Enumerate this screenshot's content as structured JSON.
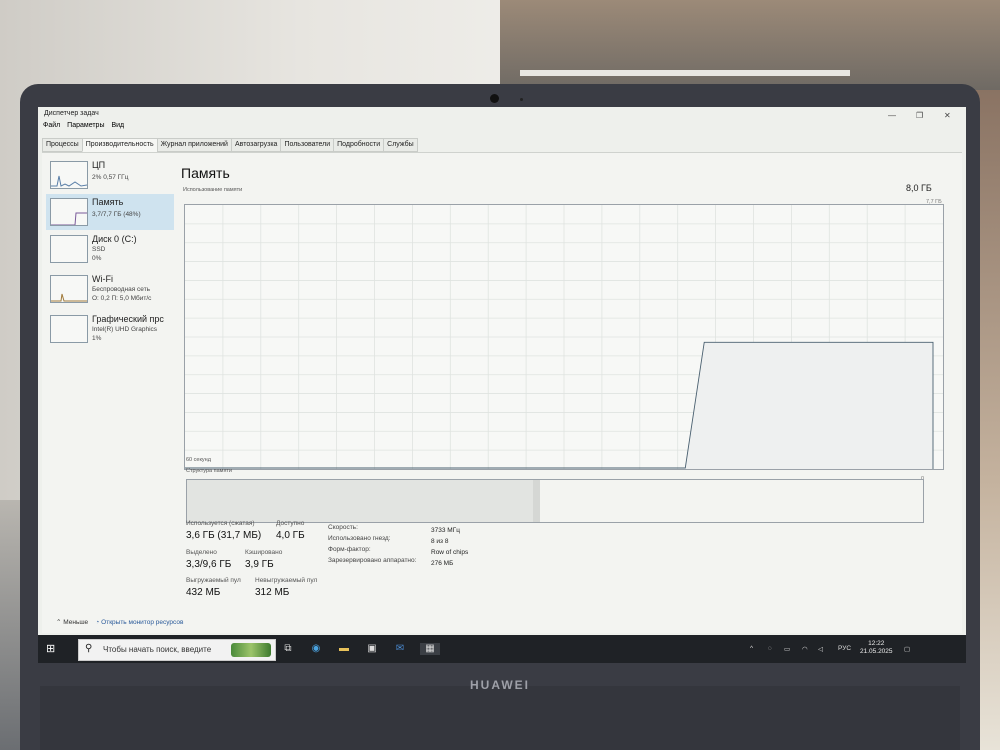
{
  "window": {
    "title": "Диспетчер задач",
    "menu": [
      "Файл",
      "Параметры",
      "Вид"
    ]
  },
  "tabs": [
    "Процессы",
    "Производительность",
    "Журнал приложений",
    "Автозагрузка",
    "Пользователи",
    "Подробности",
    "Службы"
  ],
  "active_tab": "Производительность",
  "sidebar": [
    {
      "name": "ЦП",
      "sub1": "2% 0,57 ГГц",
      "sub2": ""
    },
    {
      "name": "Память",
      "sub1": "3,7/7,7 ГБ (48%)",
      "sub2": ""
    },
    {
      "name": "Диск 0 (C:)",
      "sub1": "SSD",
      "sub2": "0%"
    },
    {
      "name": "Wi-Fi",
      "sub1": "Беспроводная сеть",
      "sub2": "О: 0,2 П: 5,0 Мбит/с"
    },
    {
      "name": "Графический прс",
      "sub1": "Intel(R) UHD Graphics",
      "sub2": "1%"
    }
  ],
  "memory": {
    "title": "Память",
    "usage_label": "Использование памяти",
    "total": "8,0 ГБ",
    "max_axis": "7,7 ГБ",
    "time_axis": "60 секунд",
    "structure_label": "Структура памяти",
    "zero": "0",
    "in_use_fraction_history_hint": "recent",
    "stats": {
      "in_use_label": "Используется (сжатая)",
      "in_use_value": "3,6 ГБ (31,7 МБ)",
      "available_label": "Доступно",
      "available_value": "4,0 ГБ",
      "committed_label": "Выделено",
      "committed_value": "3,3/9,6 ГБ",
      "cached_label": "Кэшировано",
      "cached_value": "3,9 ГБ",
      "paged_label": "Выгружаемый пул",
      "paged_value": "432 МБ",
      "nonpaged_label": "Невыгружаемый пул",
      "nonpaged_value": "312 МБ"
    },
    "specs": [
      {
        "label": "Скорость:",
        "value": "3733 МГц"
      },
      {
        "label": "Использовано гнезд:",
        "value": "8 из 8"
      },
      {
        "label": "Форм-фактор:",
        "value": "Row of chips"
      },
      {
        "label": "Зарезервировано аппаратно:",
        "value": "276 МБ"
      }
    ],
    "usage_level": 0.48,
    "in_use_share": 0.47,
    "modified_share": 0.01
  },
  "footer": {
    "less": "Меньше",
    "monitor_link": "Открыть монитор ресурсов"
  },
  "taskbar": {
    "search_placeholder": "Чтобы начать поиск, введите",
    "lang": "РУС",
    "time": "12:22",
    "date": "21.05.2025"
  },
  "device": {
    "brand": "HUAWEI"
  },
  "colors": {
    "graph_line": "#4a6070",
    "selected": "#cfe3ef",
    "taskbar": "#1f2226"
  }
}
